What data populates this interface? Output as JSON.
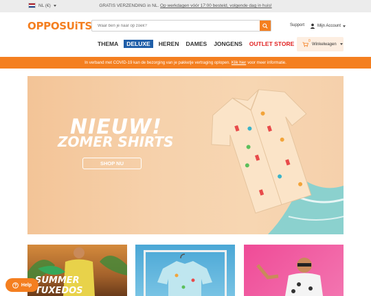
{
  "topbar": {
    "language": "NL (€)",
    "shipping_text": "GRATIS VERZENDING in NL.",
    "shipping_link": "Op werkdagen vóór 17:00 besteld, volgende dag in huis!"
  },
  "header": {
    "logo": "OPPOSUiTS",
    "search_placeholder": "Waar ben je naar op zoek?",
    "support_label": "Support",
    "account_label": "Mijn Account"
  },
  "nav": {
    "items": [
      "THEMA",
      "DELUXE",
      "HEREN",
      "DAMES",
      "JONGENS",
      "OUTLET STORE"
    ]
  },
  "cart": {
    "count": "0",
    "label": "Winkelwagen"
  },
  "banner": {
    "text_before": "In verband met COVID-19 kan de bezorging van je pakketje vertraging oplopen.",
    "link": "Klik hier",
    "text_after": "voor meer informatie."
  },
  "hero": {
    "title_line1": "NIEUW!",
    "title_line2": "ZOMER SHIRTS",
    "button": "SHOP NU"
  },
  "tiles": {
    "tile1_label": "SUMMER TUXEDOS"
  },
  "help": {
    "label": "Help"
  },
  "colors": {
    "brand": "#f47f20",
    "deluxe": "#1f5ea8",
    "outlet": "#e12222"
  }
}
